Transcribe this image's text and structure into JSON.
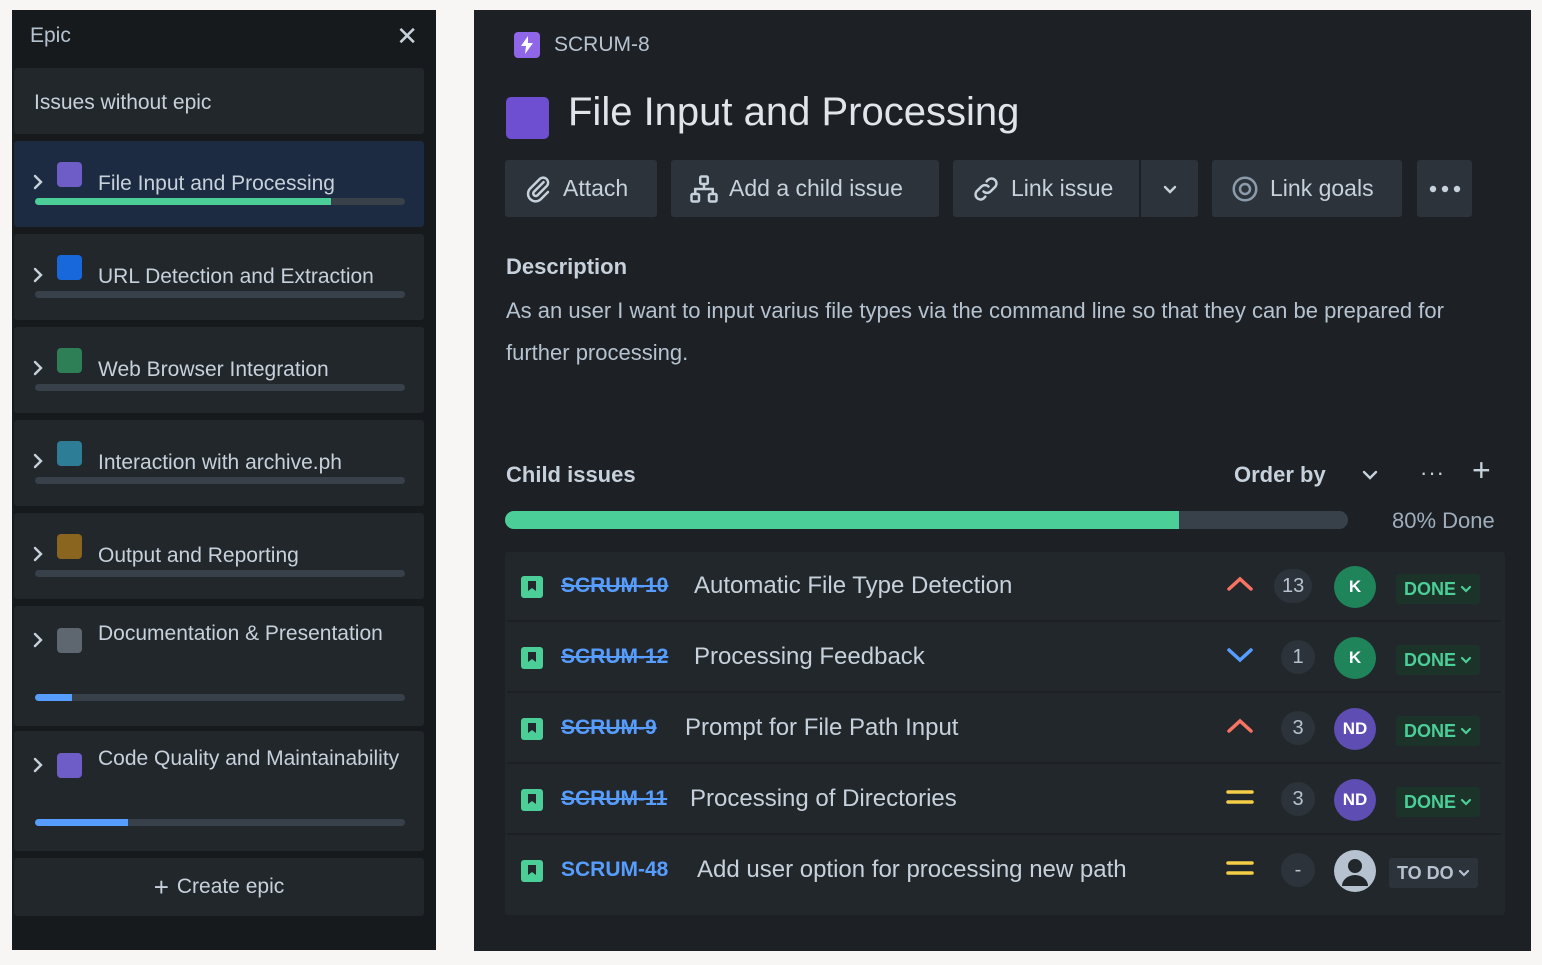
{
  "epic_panel": {
    "title": "Epic",
    "issues_without_epic": "Issues without epic",
    "epics": [
      {
        "name": "File Input and Processing",
        "color": "#6e5dc6",
        "progress": 0.8,
        "fill": "#4bce97",
        "active": true
      },
      {
        "name": "URL Detection and Extraction",
        "color": "#1868db",
        "progress": 0.0,
        "fill": "#579dff",
        "active": false
      },
      {
        "name": "Web Browser Integration",
        "color": "#2f7f56",
        "progress": 0.0,
        "fill": "#579dff",
        "active": false
      },
      {
        "name": "Interaction with archive.ph",
        "color": "#2e7d96",
        "progress": 0.0,
        "fill": "#579dff",
        "active": false
      },
      {
        "name": "Output and Reporting",
        "color": "#8a6520",
        "progress": 0.0,
        "fill": "#579dff",
        "active": false
      },
      {
        "name": "Documentation & Presentation",
        "color": "#5e6670",
        "progress": 0.1,
        "fill": "#579dff",
        "active": false
      },
      {
        "name": "Code Quality and Maintainability",
        "color": "#6e5dc6",
        "progress": 0.25,
        "fill": "#579dff",
        "active": false
      }
    ],
    "create_epic": "Create epic"
  },
  "issue": {
    "key": "SCRUM-8",
    "title": "File Input and Processing",
    "toolbar": {
      "attach": "Attach",
      "add_child": "Add a child issue",
      "link_issue": "Link issue",
      "link_goals": "Link goals"
    },
    "description_heading": "Description",
    "description": "As an user I want to input varius file types via the command line so that they can be prepared for further processing.",
    "child_issues_heading": "Child issues",
    "order_by": "Order by",
    "progress": 0.8,
    "progress_label": "80% Done",
    "children": [
      {
        "key": "SCRUM-10",
        "summary": "Automatic File Type Detection",
        "priority": "high",
        "estimate": "13",
        "assignee": "K",
        "assignee_color": "#1f845a",
        "status": "DONE",
        "done": true
      },
      {
        "key": "SCRUM-12",
        "summary": "Processing Feedback",
        "priority": "low",
        "estimate": "1",
        "assignee": "K",
        "assignee_color": "#1f845a",
        "status": "DONE",
        "done": true
      },
      {
        "key": "SCRUM-9",
        "summary": "Prompt for File Path Input",
        "priority": "high",
        "estimate": "3",
        "assignee": "ND",
        "assignee_color": "#5e4db2",
        "status": "DONE",
        "done": true
      },
      {
        "key": "SCRUM-11",
        "summary": "Processing of Directories",
        "priority": "medium",
        "estimate": "3",
        "assignee": "ND",
        "assignee_color": "#5e4db2",
        "status": "DONE",
        "done": true
      },
      {
        "key": "SCRUM-48",
        "summary": "Add user option for processing new path",
        "priority": "medium",
        "estimate": "-",
        "assignee": "",
        "assignee_color": "#b6c2cf",
        "status": "TO DO",
        "done": false
      }
    ]
  },
  "colors": {
    "done_bg": "#1c3329",
    "done_text": "#4bce97",
    "todo_bg": "#2c333a",
    "todo_text": "#b6c2cf",
    "priority_high": "#f87462",
    "priority_low": "#579dff",
    "priority_medium": "#f5cd47"
  }
}
